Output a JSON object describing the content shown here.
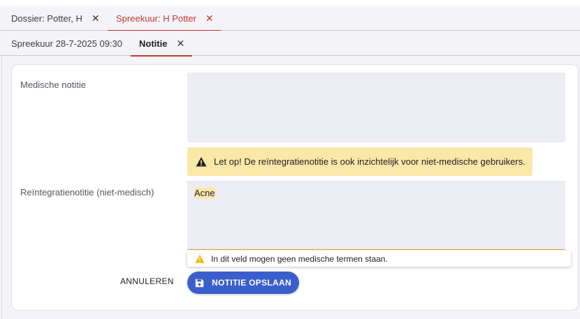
{
  "tabs_top": [
    {
      "label": "Dossier: Potter, H",
      "close": "✕"
    },
    {
      "label": "Spreekuur: H Potter",
      "close": "✕"
    }
  ],
  "tabs_sub": [
    {
      "label": "Spreekuur 28-7-2025 09:30"
    },
    {
      "label": "Notitie",
      "close": "✕"
    }
  ],
  "form": {
    "medical_label": "Medische notitie",
    "medical_value": "",
    "warning_text": "Let op! De reïntegratienotitie is ook inzichtelijk voor niet-medische gebruikers.",
    "reintegration_label": "Reïntegratienotitie (niet-medisch)",
    "reintegration_value": "Acne",
    "tooltip_text": "In dit veld mogen geen medische termen staan.",
    "cancel_label": "ANNULEREN",
    "save_label": "NOTITIE OPSLAAN"
  },
  "colors": {
    "accent_red": "#c0392b",
    "primary_blue": "#3a5fcd",
    "warning_bg": "#fbe7a8"
  },
  "icons": {
    "warning": "warning-triangle-icon",
    "save": "floppy-disk-icon",
    "close": "close-icon"
  }
}
